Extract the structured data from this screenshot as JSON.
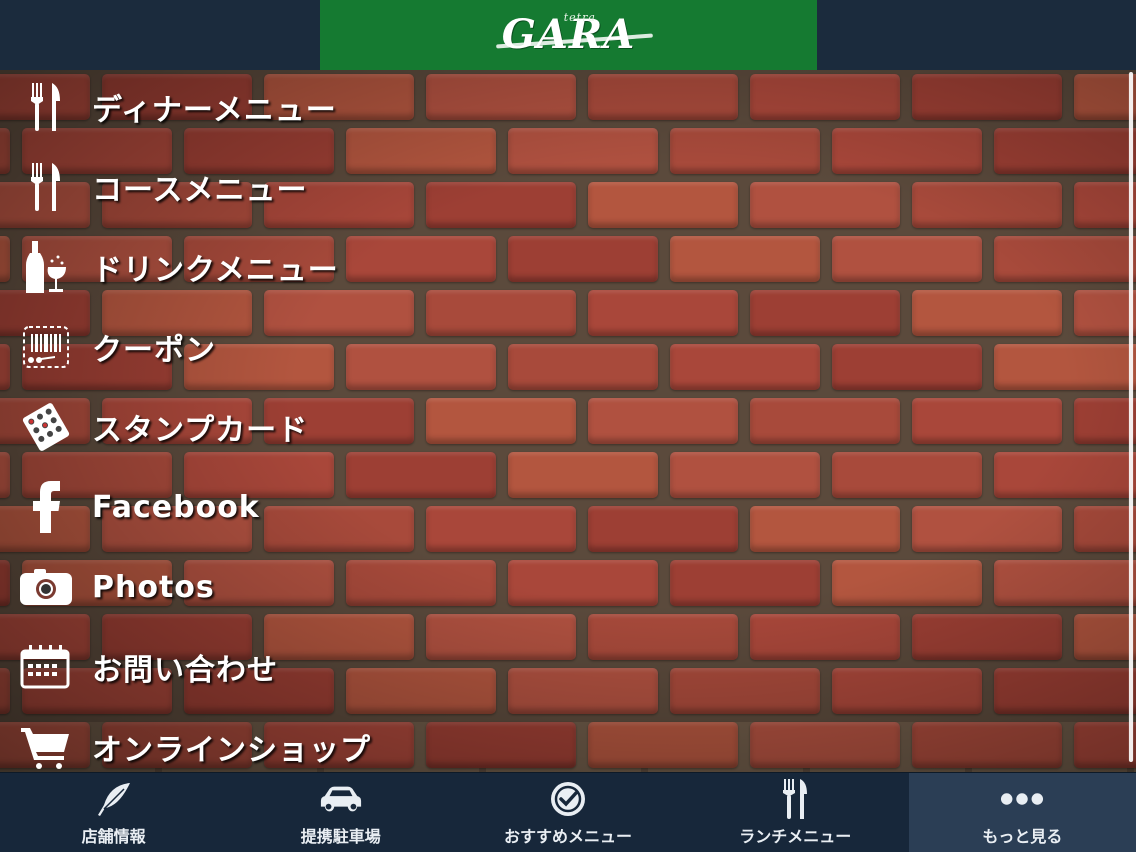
{
  "header": {
    "logo_main": "GARA",
    "logo_small": "tetra",
    "colors": {
      "bar": "#1b2b3d",
      "logo_bg": "#157a31"
    }
  },
  "menu": {
    "items": [
      {
        "label": "ディナーメニュー",
        "icon": "fork-knife-icon"
      },
      {
        "label": "コースメニュー",
        "icon": "fork-knife-icon"
      },
      {
        "label": "ドリンクメニュー",
        "icon": "bottle-glass-icon"
      },
      {
        "label": "クーポン",
        "icon": "coupon-scissors-icon"
      },
      {
        "label": "スタンプカード",
        "icon": "stamp-card-icon"
      },
      {
        "label": "Facebook",
        "icon": "facebook-icon"
      },
      {
        "label": "Photos",
        "icon": "camera-icon"
      },
      {
        "label": "お問い合わせ",
        "icon": "calendar-icon"
      },
      {
        "label": "オンラインショップ",
        "icon": "cart-icon"
      }
    ]
  },
  "bottom_nav": {
    "items": [
      {
        "label": "店舗情報",
        "icon": "feather-icon"
      },
      {
        "label": "提携駐車場",
        "icon": "car-icon"
      },
      {
        "label": "おすすめメニュー",
        "icon": "badge-check-icon"
      },
      {
        "label": "ランチメニュー",
        "icon": "fork-knife-icon"
      },
      {
        "label": "もっと見る",
        "icon": "more-dots-icon"
      }
    ],
    "active_index": 4
  }
}
